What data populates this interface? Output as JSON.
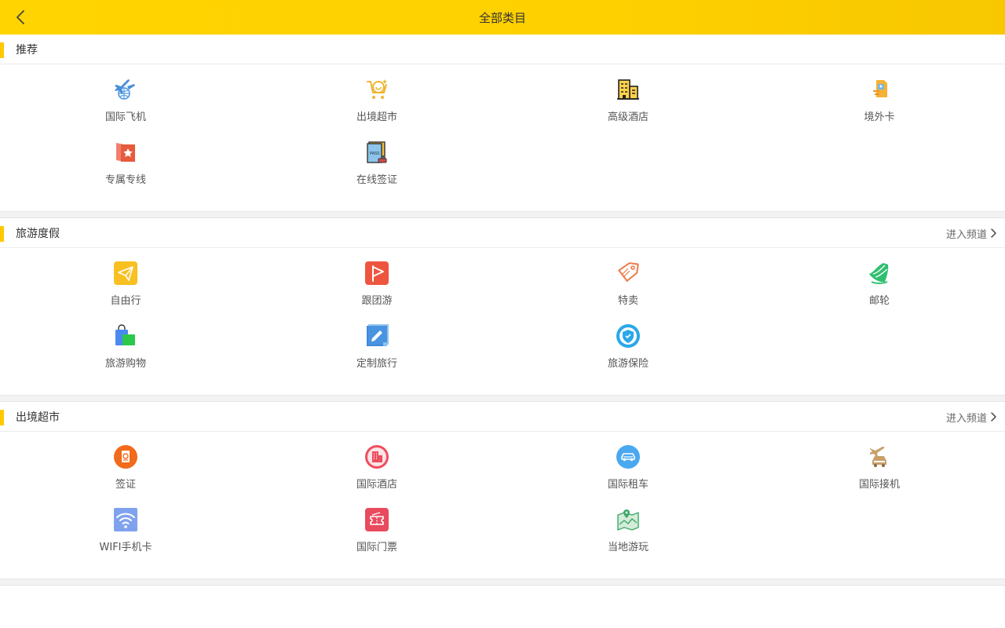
{
  "header": {
    "title": "全部类目",
    "back_icon": "chevron-left-icon"
  },
  "sections": [
    {
      "title": "推荐",
      "link": "",
      "items": [
        {
          "label": "国际飞机",
          "icon": "airplane-globe-icon"
        },
        {
          "label": "出境超市",
          "icon": "shopping-cart-icon"
        },
        {
          "label": "高级酒店",
          "icon": "hotel-building-icon"
        },
        {
          "label": "境外卡",
          "icon": "sim-card-icon"
        },
        {
          "label": "专属专线",
          "icon": "star-flag-icon"
        },
        {
          "label": "在线签证",
          "icon": "passport-stamp-icon"
        }
      ]
    },
    {
      "title": "旅游度假",
      "link": "进入频道",
      "items": [
        {
          "label": "自由行",
          "icon": "paper-plane-icon"
        },
        {
          "label": "跟团游",
          "icon": "tour-flag-icon"
        },
        {
          "label": "特卖",
          "icon": "price-tag-icon"
        },
        {
          "label": "邮轮",
          "icon": "cruise-ship-icon"
        },
        {
          "label": "旅游购物",
          "icon": "shopping-bag-icon"
        },
        {
          "label": "定制旅行",
          "icon": "edit-pencil-icon"
        },
        {
          "label": "旅游保险",
          "icon": "shield-icon"
        }
      ]
    },
    {
      "title": "出境超市",
      "link": "进入频道",
      "items": [
        {
          "label": "签证",
          "icon": "passport-circle-icon"
        },
        {
          "label": "国际酒店",
          "icon": "hotel-circle-icon"
        },
        {
          "label": "国际租车",
          "icon": "car-circle-icon"
        },
        {
          "label": "国际接机",
          "icon": "airport-pickup-icon"
        },
        {
          "label": "WIFI手机卡",
          "icon": "wifi-icon"
        },
        {
          "label": "国际门票",
          "icon": "ticket-icon"
        },
        {
          "label": "当地游玩",
          "icon": "map-pin-icon"
        }
      ]
    }
  ],
  "colors": {
    "header_bg": "#ffd400",
    "section_marker": "#ffc800",
    "divider_bg": "#f2f2f2"
  }
}
